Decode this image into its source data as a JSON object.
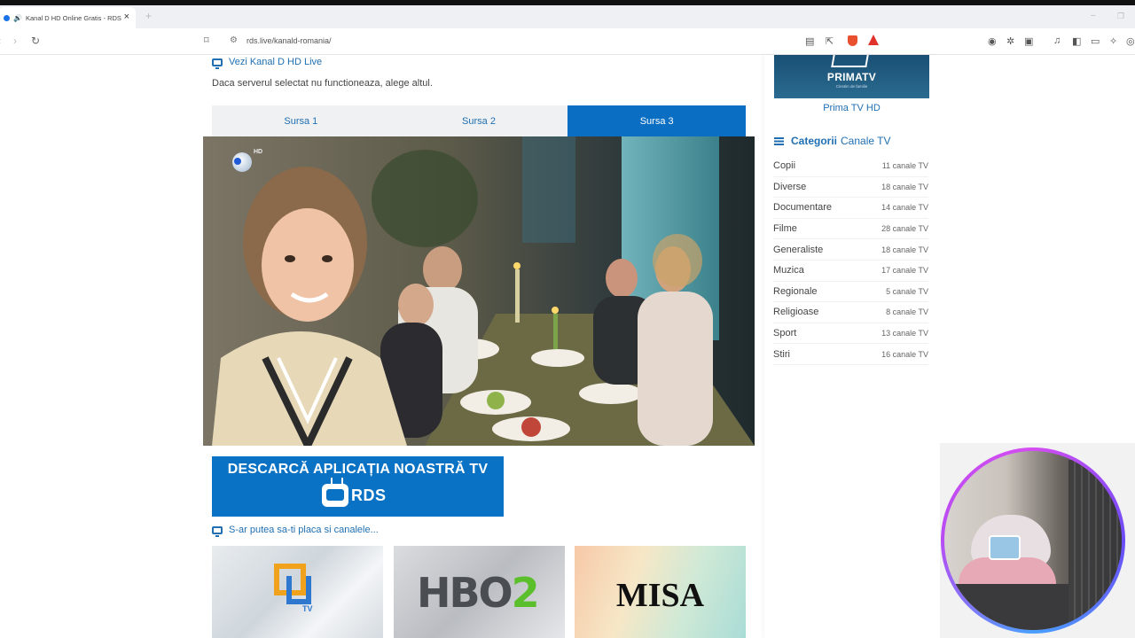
{
  "browser": {
    "tab_title": "Kanal D HD Online Gratis - RDS",
    "tab_close": "×",
    "new_tab": "+",
    "url": "rds.live/kanald-romania/"
  },
  "main": {
    "live_heading": "Vezi Kanal D HD Live",
    "notice": "Daca serverul selectat nu functioneaza, alege altul.",
    "sources": [
      {
        "label": "Sursa 1",
        "active": false
      },
      {
        "label": "Sursa 2",
        "active": false
      },
      {
        "label": "Sursa 3",
        "active": true
      }
    ],
    "video_logo_hd": "HD",
    "app_banner_title": "DESCARCĂ APLICAȚIA NOASTRĂ TV",
    "app_banner_brand": "RDS",
    "suggest_heading": "S-ar putea sa-ti placa si canalele...",
    "suggestions": [
      {
        "name": "QU TV",
        "logo_text": "TV"
      },
      {
        "name": "HBO 2",
        "logo_text": "HBO",
        "logo_num": "2"
      },
      {
        "name": "MISA",
        "logo_text": "MISA"
      }
    ]
  },
  "sidebar": {
    "banner_text": "PRIMATV",
    "banner_sub": "Cinstim de familie",
    "channel_name": "Prima TV HD",
    "categories_heading": "Categorii",
    "categories_heading_suffix": "Canale TV",
    "categories": [
      {
        "name": "Copii",
        "count": "11 canale TV"
      },
      {
        "name": "Diverse",
        "count": "18 canale TV"
      },
      {
        "name": "Documentare",
        "count": "14 canale TV"
      },
      {
        "name": "Filme",
        "count": "28 canale TV"
      },
      {
        "name": "Generaliste",
        "count": "18 canale TV"
      },
      {
        "name": "Muzica",
        "count": "17 canale TV"
      },
      {
        "name": "Regionale",
        "count": "5 canale TV"
      },
      {
        "name": "Religioase",
        "count": "8 canale TV"
      },
      {
        "name": "Sport",
        "count": "13 canale TV"
      },
      {
        "name": "Stiri",
        "count": "16 canale TV"
      }
    ]
  },
  "colors": {
    "accent": "#0a6fc2",
    "link": "#1f6fb2"
  }
}
